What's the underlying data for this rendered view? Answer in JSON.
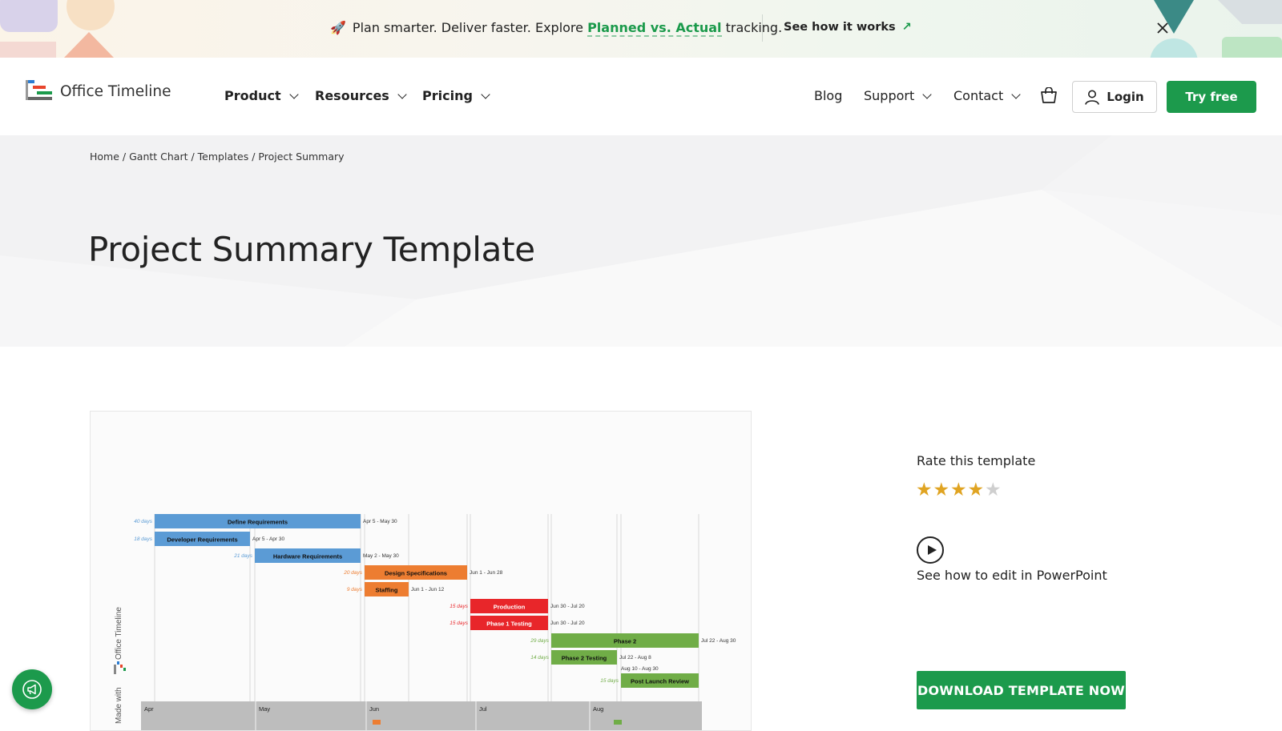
{
  "banner": {
    "emoji": "🚀",
    "text_before": "Plan smarter. Deliver faster. Explore ",
    "highlight": "Planned vs. Actual",
    "text_after": " tracking.",
    "cta": "See how it works",
    "cta_arrow": "↗",
    "close_icon": "×"
  },
  "header": {
    "logo_text": "Office Timeline",
    "nav_left": [
      "Product",
      "Resources",
      "Pricing"
    ],
    "nav_right": {
      "blog": "Blog",
      "support": "Support",
      "contact": "Contact"
    },
    "login": "Login",
    "try_free": "Try free"
  },
  "hero": {
    "breadcrumb": {
      "home": "Home",
      "gantt": "Gantt Chart",
      "templates": "Templates",
      "current": "Project Summary",
      "separator": " / "
    },
    "title": "Project Summary Template"
  },
  "preview": {
    "watermark": "Made with",
    "watermark_brand": "Office Timeline",
    "tasks": [
      {
        "name": "Define Requirements",
        "duration": "40 days",
        "dates": "Apr 5 - May 30",
        "color": "#5b9bd5"
      },
      {
        "name": "Developer Requirements",
        "duration": "18 days",
        "dates": "Apr 5 - Apr 30",
        "color": "#5b9bd5"
      },
      {
        "name": "Hardware Requirements",
        "duration": "21 days",
        "dates": "May 2 - May 30",
        "color": "#5b9bd5"
      },
      {
        "name": "Design Specifications",
        "duration": "20 days",
        "dates": "Jun 1 - Jun 28",
        "color": "#ed7d31"
      },
      {
        "name": "Staffing",
        "duration": "9 days",
        "dates": "Jun 1 - Jun 12",
        "color": "#ed7d31"
      },
      {
        "name": "Production",
        "duration": "15 days",
        "dates": "Jun 30 - Jul 20",
        "color": "#e8262a"
      },
      {
        "name": "Phase 1 Testing",
        "duration": "15 days",
        "dates": "Jun 30 - Jul 20",
        "color": "#e8262a"
      },
      {
        "name": "Phase 2",
        "duration": "29 days",
        "dates": "Jul 22 - Aug 30",
        "color": "#70ad47"
      },
      {
        "name": "Phase 2 Testing",
        "duration": "14 days",
        "dates": "Jul 22 - Aug 8",
        "color": "#70ad47"
      },
      {
        "name": "Post Launch Review",
        "duration": "15 days",
        "dates": "Aug 10 - Aug 30",
        "color": "#70ad47"
      }
    ],
    "months": [
      "Apr",
      "May",
      "Jun",
      "Jul",
      "Aug"
    ]
  },
  "sidebar": {
    "rate_label": "Rate this template",
    "rating": 4,
    "max_rating": 5,
    "star_glyph": "★",
    "edit_label": "See how to edit in PowerPoint",
    "download": "DOWNLOAD TEMPLATE NOW"
  },
  "colors": {
    "brand_green": "#1c9a4c",
    "star_gold": "#e0a422",
    "star_empty": "#cfcfcf"
  },
  "icons": {
    "close": "close-icon",
    "cart": "shopping-bag-icon",
    "user": "user-icon",
    "play": "play-icon",
    "feedback": "megaphone-icon"
  }
}
